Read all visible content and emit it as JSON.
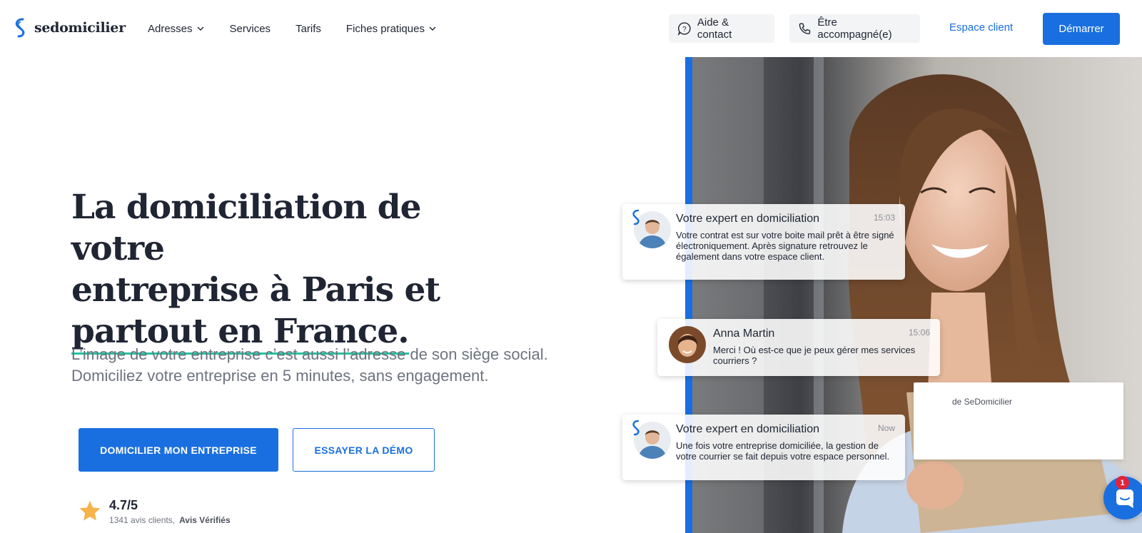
{
  "header": {
    "logo_text": "sedomicilier",
    "nav": [
      {
        "label": "Adresses",
        "has_dropdown": true
      },
      {
        "label": "Services",
        "has_dropdown": false
      },
      {
        "label": "Tarifs",
        "has_dropdown": false
      },
      {
        "label": "Fiches pratiques",
        "has_dropdown": true
      }
    ],
    "help_label": "Aide & contact",
    "accompany_label": "Être accompagné(e)",
    "client_label": "Espace client",
    "start_label": "Démarrer"
  },
  "hero": {
    "title_line1": "La domiciliation de votre",
    "title_line2": "entreprise à Paris et",
    "title_line3": "partout en France.",
    "subtitle_line1": "L’image de votre entreprise c’est aussi l’adresse de son siège social.",
    "subtitle_line2": "Domiciliez votre entreprise en 5 minutes, sans engagement.",
    "cta_primary": "DOMICILIER MON ENTREPRISE",
    "cta_secondary": "ESSAYER LA DÉMO",
    "rating_score": "4.7/5",
    "rating_count": "1341 avis clients,",
    "rating_source": "Avis Vérifiés"
  },
  "chat": {
    "messages": [
      {
        "name": "Votre expert en domiciliation",
        "time": "15:03",
        "text": "Votre contrat est sur votre boite mail prêt à être signé électroniquement. Après signature retrouvez le également dans votre espace client."
      },
      {
        "name": "Anna Martin",
        "time": "15:06",
        "text": "Merci ! Où est-ce que je peux gérer mes services courriers ?"
      },
      {
        "name": "Votre expert en domiciliation",
        "time": "Now",
        "text": "Une fois votre entreprise domiciliée, la gestion de votre courrier se fait depuis votre espace personnel."
      }
    ],
    "widget_caption": "de SeDomicilier",
    "unread_count": "1"
  },
  "colors": {
    "brand_blue": "#1a6fe0",
    "accent_green": "#27c2a0",
    "text_dark": "#1f2533",
    "text_muted": "#6e7380",
    "star": "#f7b24a",
    "badge_red": "#e0243b"
  },
  "icons": [
    "logo-icon",
    "chevron-down-icon",
    "help-bubble-icon",
    "phone-icon",
    "star-icon",
    "chat-launcher-icon"
  ]
}
